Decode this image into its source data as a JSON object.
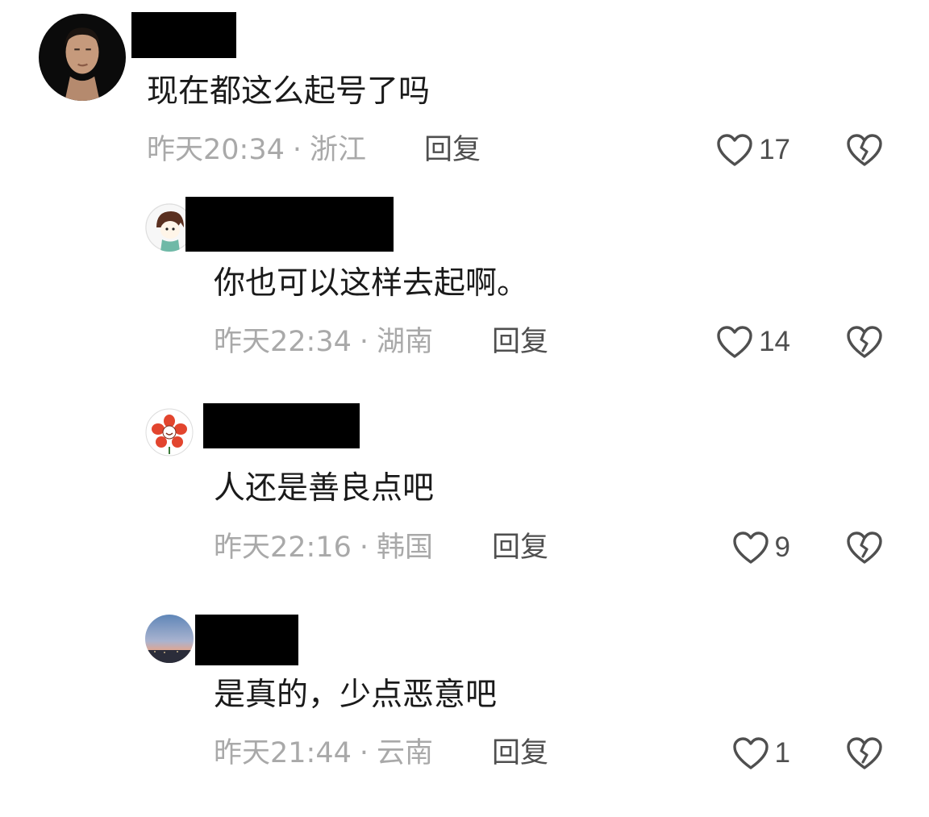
{
  "comments": [
    {
      "text": "现在都这么起号了吗",
      "time": "昨天20:34",
      "location": "浙江",
      "reply_label": "回复",
      "likes": "17",
      "avatar_icon": "man-portrait-avatar"
    },
    {
      "text": "你也可以这样去起啊。",
      "time": "昨天22:34",
      "location": "湖南",
      "reply_label": "回复",
      "likes": "14",
      "avatar_icon": "cartoon-boy-avatar"
    },
    {
      "text": "人还是善良点吧",
      "time": "昨天22:16",
      "location": "韩国",
      "reply_label": "回复",
      "likes": "9",
      "avatar_icon": "red-flower-avatar"
    },
    {
      "text": "是真的，少点恶意吧",
      "time": "昨天21:44",
      "location": "云南",
      "reply_label": "回复",
      "likes": "1",
      "avatar_icon": "sunset-sky-avatar"
    }
  ],
  "meta_separator": "·",
  "colors": {
    "text": "#1a1a1a",
    "meta": "#a9a9a9",
    "icon": "#4f4f4f",
    "redaction": "#000000"
  }
}
